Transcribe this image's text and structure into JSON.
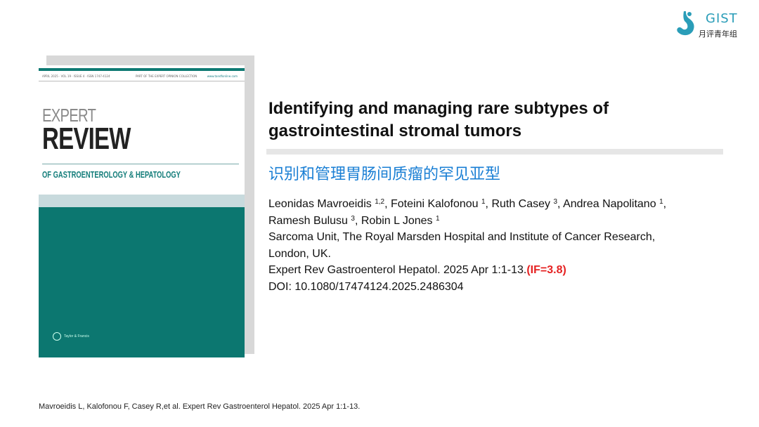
{
  "logo": {
    "name": "GIST",
    "subtitle": "月评青年组",
    "icon": "stomach-icon",
    "color": "#2a9db8"
  },
  "cover": {
    "meta_left": "APRIL 2025 · VOL 19 · ISSUE 4 · ISSN 1747-4124",
    "meta_mid": "PART OF THE EXPERT OPINION COLLECTION",
    "meta_right": "www.tandfonline.com",
    "word1": "EXPERT",
    "word2": "REVIEW",
    "subtitle": "OF GASTROENTEROLOGY & HEPATOLOGY",
    "publisher": "Taylor & Francis",
    "teal_color": "#0c7770"
  },
  "article": {
    "title_line1": "Identifying and managing rare subtypes of",
    "title_line2": "gastrointestinal stromal tumors",
    "title_cn": "识别和管理胃肠间质瘤的罕见亚型",
    "authors": [
      {
        "name": "Leonidas Mavroeidis",
        "aff": "1,2"
      },
      {
        "name": "Foteini Kalofonou",
        "aff": "1"
      },
      {
        "name": "Ruth Casey",
        "aff": "3"
      },
      {
        "name": "Andrea Napolitano",
        "aff": "1"
      },
      {
        "name": "Ramesh Bulusu",
        "aff": "3"
      },
      {
        "name": "Robin L Jones",
        "aff": "1"
      }
    ],
    "affiliation_line1": "Sarcoma Unit, The Royal Marsden Hospital and Institute of Cancer Research,",
    "affiliation_line2": "London, UK.",
    "journal": "Expert Rev Gastroenterol Hepatol. 2025 Apr 1:1-13.",
    "impact_factor": "(IF=3.8)",
    "doi": "DOI: 10.1080/17474124.2025.2486304",
    "if_color": "#e52222"
  },
  "footer": {
    "citation": "Mavroeidis L, Kalofonou F, Casey R,et al. Expert Rev Gastroenterol Hepatol. 2025 Apr 1:1-13."
  }
}
